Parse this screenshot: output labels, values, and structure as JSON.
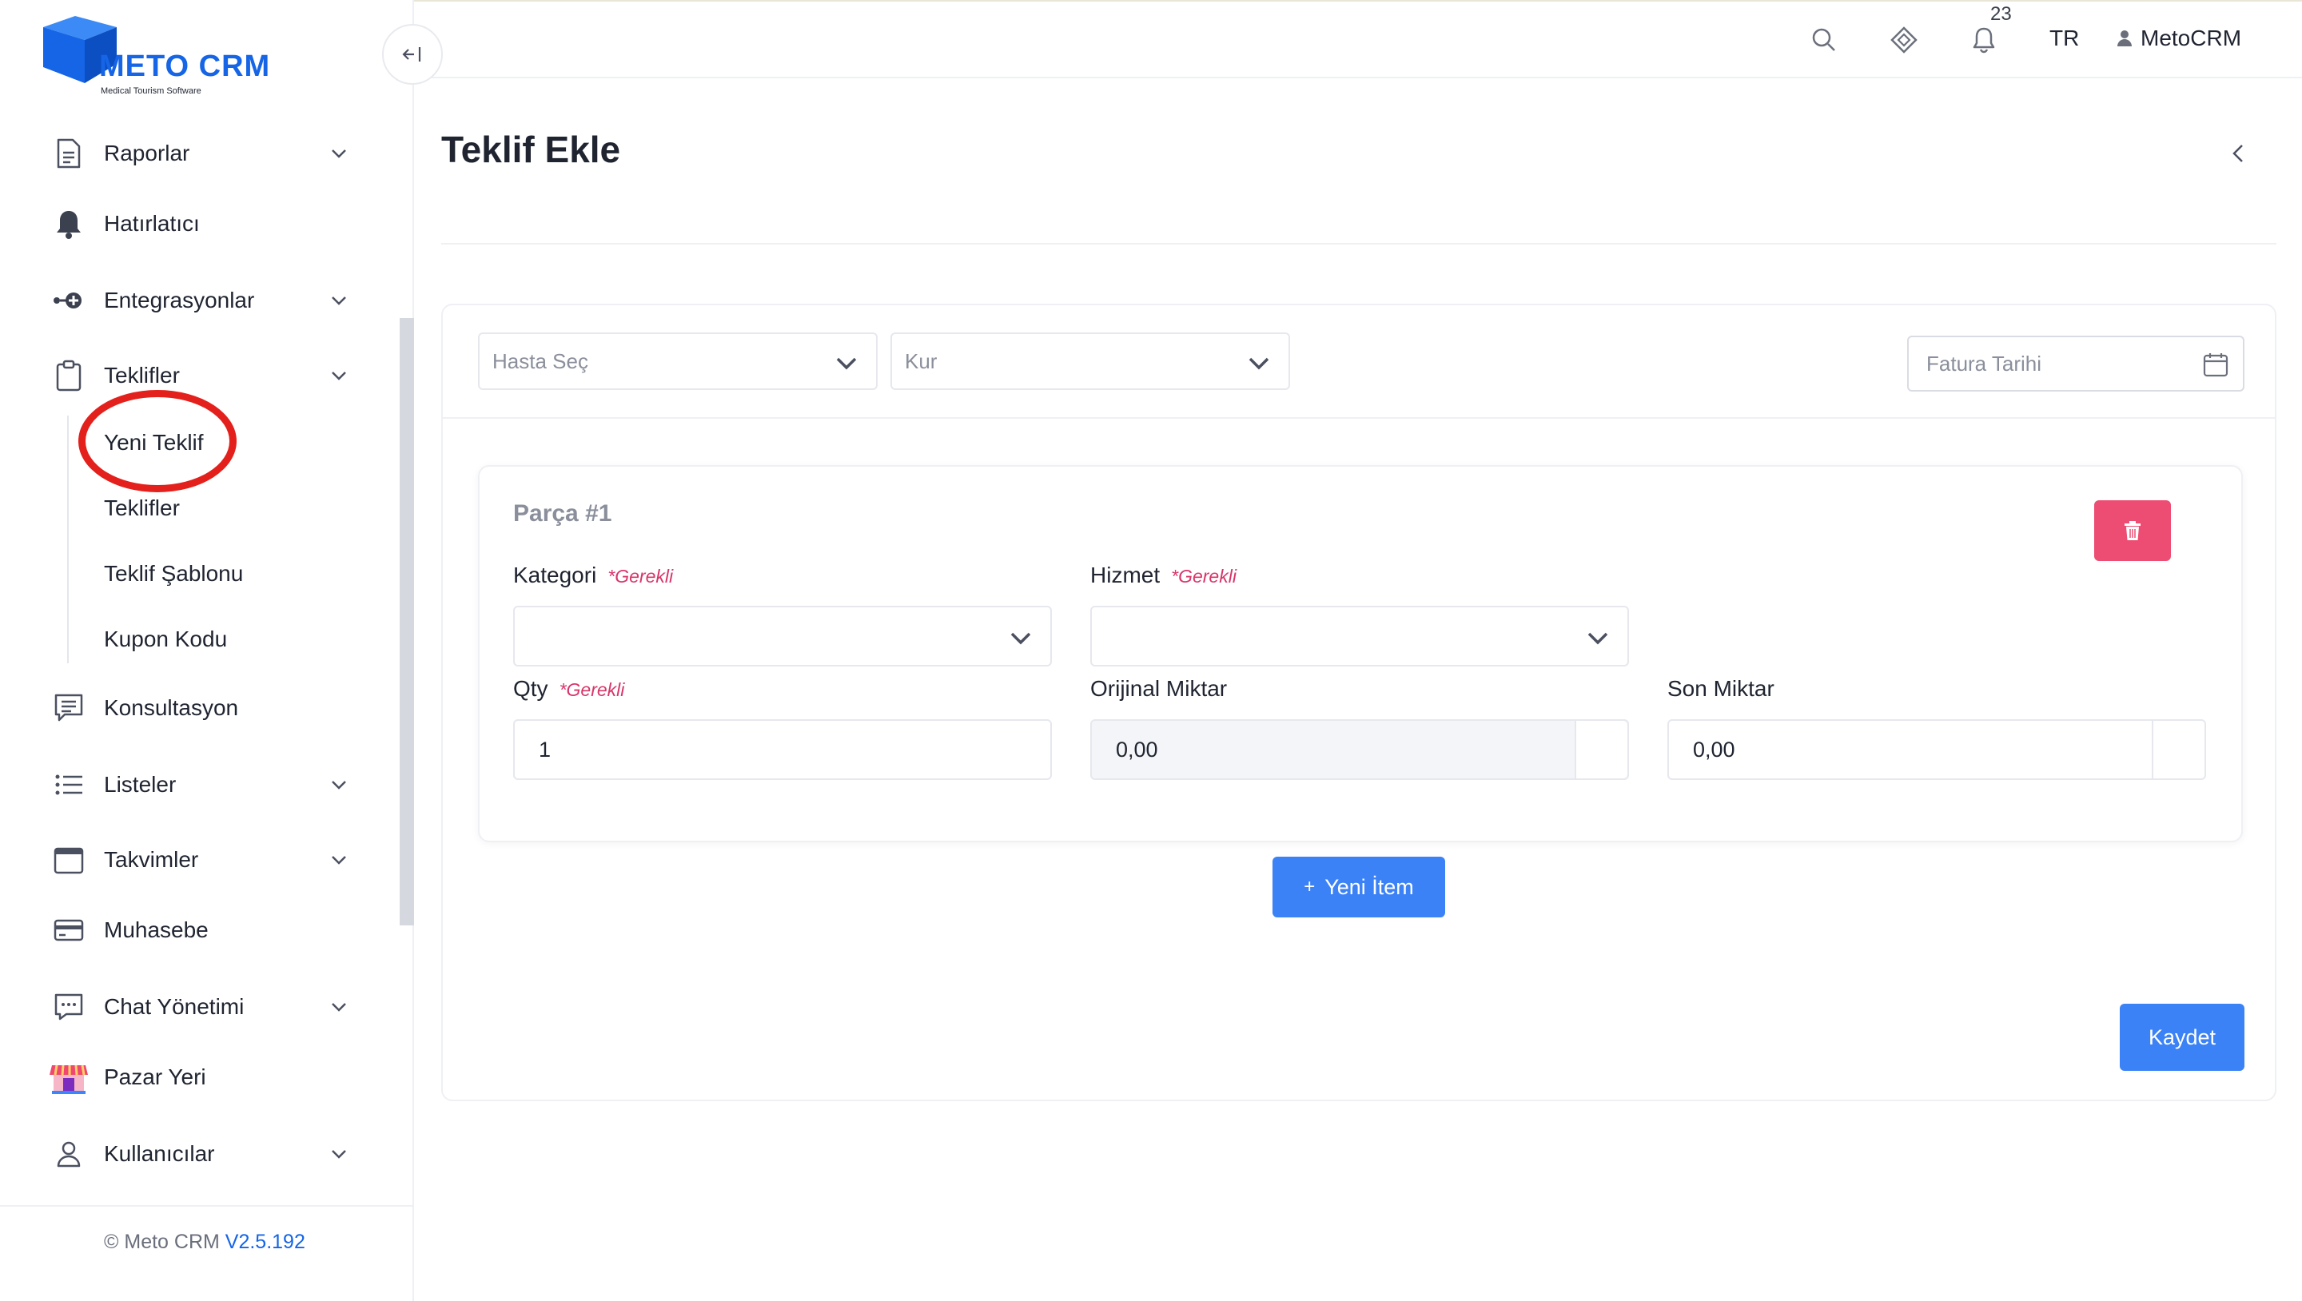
{
  "brand": {
    "name": "METO CRM",
    "tagline": "Medical Tourism Software",
    "color": "#1565e6"
  },
  "sidebar": {
    "items": [
      {
        "label": "Raporlar",
        "icon": "document-icon",
        "has_children": true
      },
      {
        "label": "Hatırlatıcı",
        "icon": "bell-icon",
        "has_children": false
      },
      {
        "label": "Entegrasyonlar",
        "icon": "integration-icon",
        "has_children": true
      },
      {
        "label": "Teklifler",
        "icon": "clipboard-icon",
        "has_children": true,
        "expanded": true
      },
      {
        "label": "Konsultasyon",
        "icon": "chat-list-icon",
        "has_children": false
      },
      {
        "label": "Listeler",
        "icon": "list-icon",
        "has_children": true
      },
      {
        "label": "Takvimler",
        "icon": "calendar-icon",
        "has_children": true
      },
      {
        "label": "Muhasebe",
        "icon": "credit-card-icon",
        "has_children": false
      },
      {
        "label": "Chat Yönetimi",
        "icon": "chat-bubble-icon",
        "has_children": true
      },
      {
        "label": "Pazar Yeri",
        "icon": "store-icon",
        "has_children": false
      },
      {
        "label": "Kullanıcılar",
        "icon": "user-icon",
        "has_children": true
      }
    ],
    "sub_items": [
      {
        "label": "Yeni Teklif",
        "highlighted": true
      },
      {
        "label": "Teklifler"
      },
      {
        "label": "Teklif Şablonu"
      },
      {
        "label": "Kupon Kodu"
      }
    ],
    "footer": {
      "copyright": "© Meto CRM",
      "version": "V2.5.192"
    }
  },
  "topbar": {
    "notification_count": "23",
    "language": "TR",
    "user_name": "MetoCRM"
  },
  "page": {
    "title": "Teklif Ekle"
  },
  "form": {
    "patient_select_placeholder": "Hasta Seç",
    "currency_select_placeholder": "Kur",
    "invoice_date_placeholder": "Fatura Tarihi",
    "part": {
      "title": "Parça #1",
      "category_label": "Kategori",
      "service_label": "Hizmet",
      "qty_label": "Qty",
      "required_text": "*Gerekli",
      "original_amount_label": "Orijinal Miktar",
      "final_amount_label": "Son Miktar",
      "qty_value": "1",
      "original_amount_value": "0,00",
      "final_amount_value": "0,00"
    },
    "new_item_label": "Yeni İtem",
    "save_label": "Kaydet"
  },
  "colors": {
    "primary": "#3b82f6",
    "danger": "#ee4d73",
    "required": "#d8366a",
    "highlight_ring": "#e3201b"
  }
}
